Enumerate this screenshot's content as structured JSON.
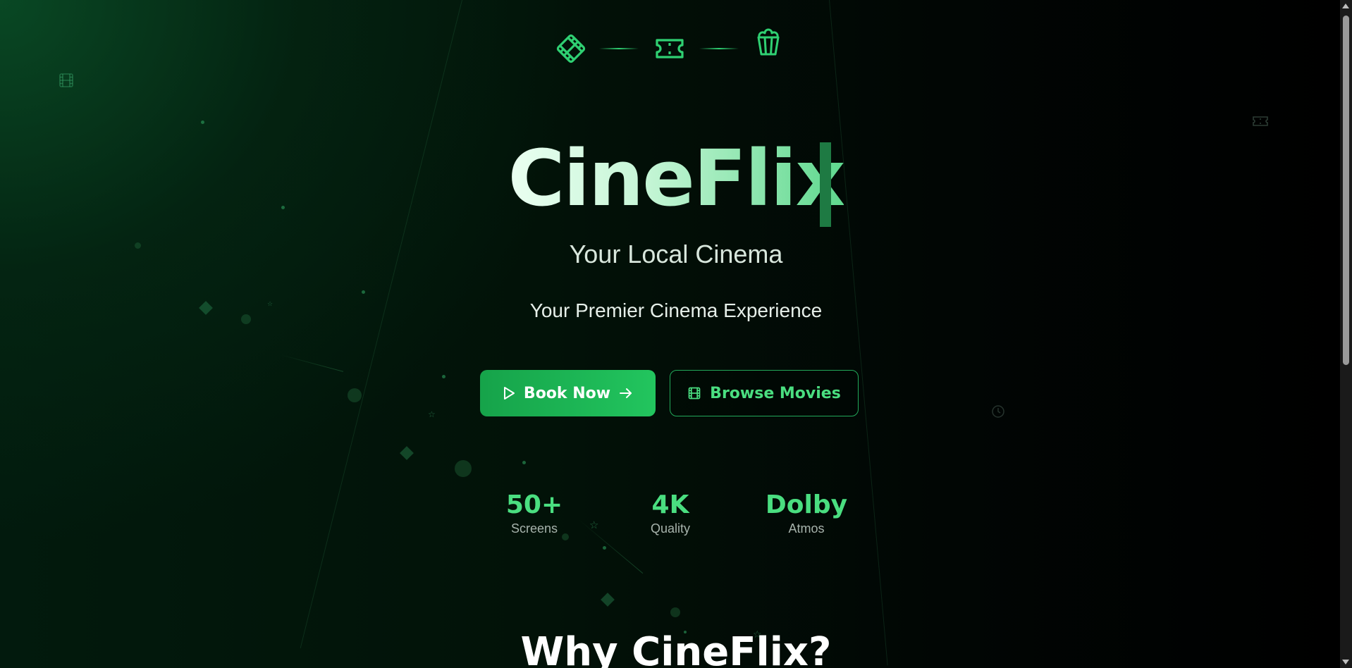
{
  "brand": {
    "title": "CineFlix",
    "subtitle": "Your Local Cinema",
    "tagline": "Your Premier Cinema Experience"
  },
  "top_icons": [
    "film-icon",
    "ticket-icon",
    "popcorn-icon"
  ],
  "buttons": {
    "primary": {
      "label": "Book Now",
      "icon": "play-icon",
      "trailing_icon": "arrow-right-icon"
    },
    "secondary": {
      "label": "Browse Movies",
      "icon": "film-icon"
    }
  },
  "stats": [
    {
      "value": "50+",
      "label": "Screens"
    },
    {
      "value": "4K",
      "label": "Quality"
    },
    {
      "value": "Dolby",
      "label": "Atmos"
    }
  ],
  "section_heading": "Why CineFlix?",
  "colors": {
    "accent": "#22c55e",
    "accent_light": "#4ade80",
    "background": "#000000"
  }
}
